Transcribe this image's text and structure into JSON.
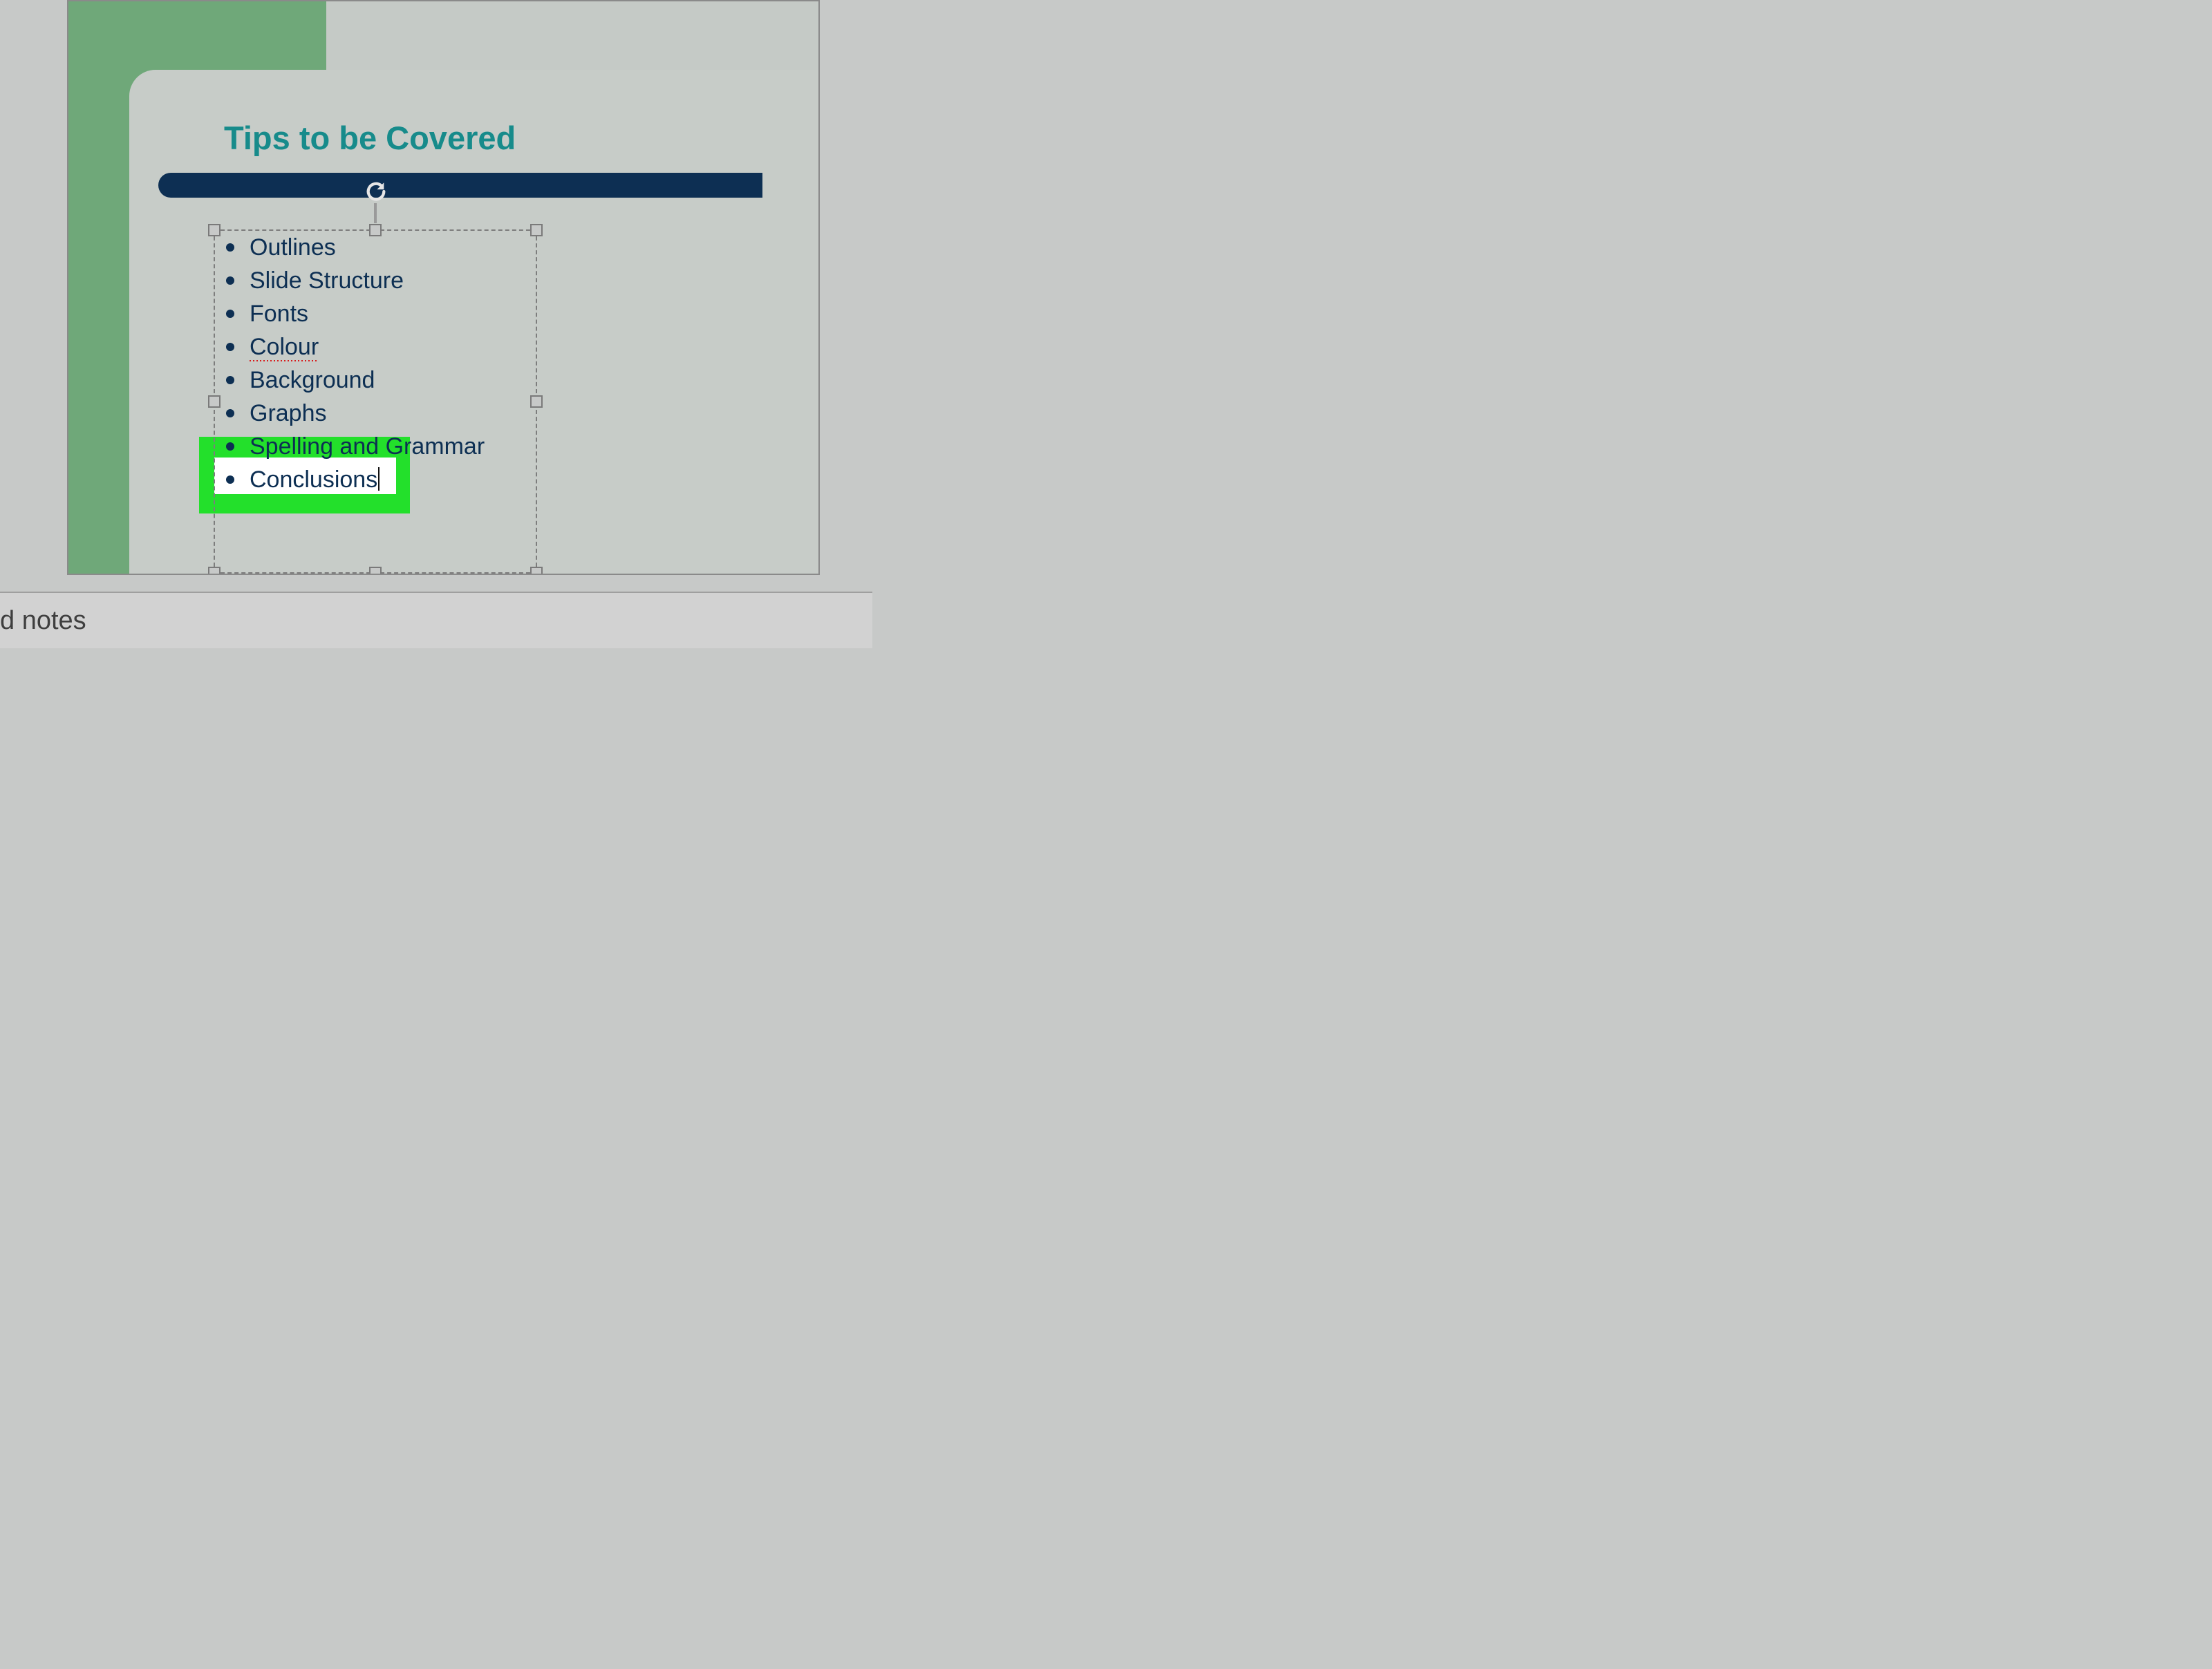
{
  "slide": {
    "title": "Tips to be Covered",
    "bullets": [
      {
        "text": "Outlines",
        "flag": ""
      },
      {
        "text": "Slide Structure",
        "flag": ""
      },
      {
        "text": "Fonts",
        "flag": ""
      },
      {
        "text": "Colour",
        "flag": "spell"
      },
      {
        "text": "Background",
        "flag": ""
      },
      {
        "text": "Graphs",
        "flag": ""
      },
      {
        "text": "Spelling and Grammar",
        "flag": ""
      },
      {
        "text": "Conclusions",
        "flag": "caret"
      }
    ]
  },
  "notes": {
    "placeholder_fragment": "d notes"
  },
  "highlight": {
    "target_bullet_index": 7,
    "color": "#23e02b"
  },
  "colors": {
    "title": "#178b8b",
    "text": "#0d2f53",
    "accent_green": "#6fa879",
    "navy_bar": "#0d2f53"
  }
}
